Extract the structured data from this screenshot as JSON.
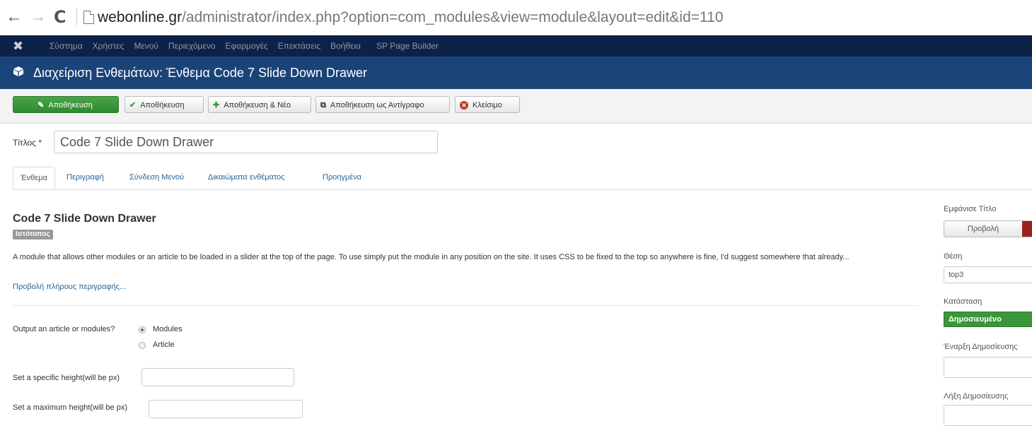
{
  "browser": {
    "url_host": "webonline.gr",
    "url_path": "/administrator/index.php?option=com_modules&view=module&layout=edit&id=110"
  },
  "topmenu": {
    "logo_icon": "joomla-logo-icon",
    "items": [
      "Σύστημα",
      "Χρήστες",
      "Μενού",
      "Περιεχόμενο",
      "Εφαρμογές",
      "Επεκτάσεις",
      "Βοήθεια",
      "SP Page Builder"
    ]
  },
  "header": {
    "icon": "cube-icon",
    "title": "Διαχείριση Ενθεμάτων: Ένθεμα Code 7 Slide Down Drawer"
  },
  "toolbar": {
    "save": "Αποθήκευση",
    "apply": "Αποθήκευση",
    "save_new": "Αποθήκευση & Νέο",
    "save_copy": "Αποθήκευση ως Αντίγραφο",
    "close": "Κλείσιμο",
    "colors": {
      "save_green": "#2f8a2f",
      "close_red": "#c0392b"
    }
  },
  "form": {
    "title_label": "Τίτλος *",
    "title_value": "Code 7 Slide Down Drawer"
  },
  "tabs": [
    "Ένθεμα",
    "Περιγραφή",
    "Σύνδεση Μενού",
    "Δικαιώματα ενθέματος",
    "Προηγμένα"
  ],
  "module": {
    "name": "Code 7 Slide Down Drawer",
    "badge": "Ιστότοπος",
    "description": "A module that allows other modules or an article to be loaded in a slider at the top of the page. To use simply put the module in any position on the site. It uses CSS to be fixed to the top so anywhere is fine, I'd suggest somewhere that already...",
    "more_link": "Προβολή πλήρους περιγραφής...",
    "output_label": "Output an article or modules?",
    "output_options": [
      "Modules",
      "Article"
    ],
    "output_selected": "Modules",
    "height_label": "Set a specific height(will be px)",
    "max_height_label": "Set a maximum height(will be px)"
  },
  "sidebar": {
    "show_title_label": "Εμφάνισε Τίτλο",
    "show_title_value": "Προβολή",
    "position_label": "Θέση",
    "position_value": "top3",
    "status_label": "Κατάσταση",
    "status_value": "Δημοσιευμένο",
    "publish_up_label": "Έναρξη Δημοσίευσης",
    "publish_down_label": "Λήξη Δημοσίευσης",
    "colors": {
      "status_green": "#3a963a",
      "toggle_red": "#9c2020"
    }
  }
}
